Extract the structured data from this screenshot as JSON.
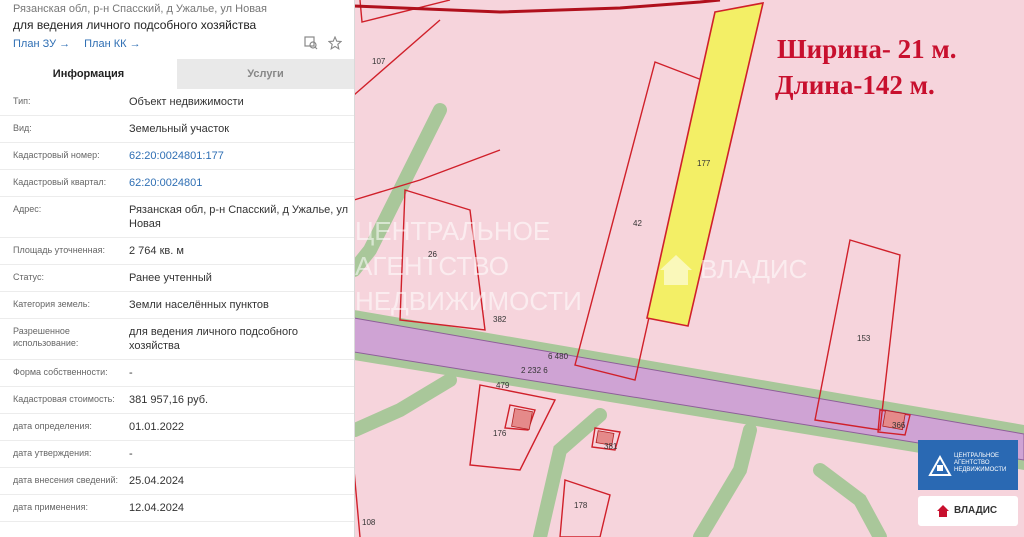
{
  "header": {
    "line1": "Рязанская обл, р-н Спасский, д Ужалье, ул Новая",
    "line2": "для ведения личного подсобного хозяйства",
    "links": [
      "План ЗУ →",
      "План КК →"
    ]
  },
  "tabs": [
    "Информация",
    "Услуги"
  ],
  "rows": [
    {
      "label": "Тип:",
      "value": "Объект недвижимости"
    },
    {
      "label": "Вид:",
      "value": "Земельный участок"
    },
    {
      "label": "Кадастровый номер:",
      "value": "62:20:0024801:177"
    },
    {
      "label": "Кадастровый квартал:",
      "value": "62:20:0024801"
    },
    {
      "label": "Адрес:",
      "value": "Рязанская обл, р-н Спасский, д Ужалье, ул Новая"
    },
    {
      "label": "Площадь уточненная:",
      "value": "2 764 кв. м"
    },
    {
      "label": "Статус:",
      "value": "Ранее учтенный"
    },
    {
      "label": "Категория земель:",
      "value": "Земли населённых пунктов"
    },
    {
      "label": "Разрешенное использование:",
      "value": "для ведения личного подсобного хозяйства"
    },
    {
      "label": "Форма собственности:",
      "value": "-"
    },
    {
      "label": "Кадастровая стоимость:",
      "value": "381 957,16 руб."
    },
    {
      "label": "дата определения:",
      "value": "01.01.2022"
    },
    {
      "label": "дата утверждения:",
      "value": "-"
    },
    {
      "label": "дата внесения сведений:",
      "value": "25.04.2024"
    },
    {
      "label": "дата применения:",
      "value": "12.04.2024"
    }
  ],
  "map": {
    "caption_width": "Ширина- 21 м.",
    "caption_length": "Длина-142 м.",
    "parcel_labels": [
      "107",
      "177",
      "42",
      "26",
      "382",
      "153",
      "6 480",
      "2 232 6",
      "479",
      "176",
      "366",
      "381",
      "178",
      "108"
    ],
    "watermark": [
      "ЦЕНТРАЛЬНОЕ",
      "АГЕНТСТВО",
      "НЕДВИЖИМОСТИ",
      "ВЛАДИС"
    ],
    "logo_text": [
      "ЦЕНТРАЛЬНОЕ",
      "АГЕНТСТВО",
      "НЕДВИЖИМОСТИ"
    ],
    "logo_badge": "ВЛАДИС",
    "colors": {
      "parcel_fill": "#f6d4dc",
      "border": "#d0202a",
      "road": "#a9c79a",
      "highlight": "#f3ef66",
      "road_band": "#cfa3d4"
    }
  }
}
